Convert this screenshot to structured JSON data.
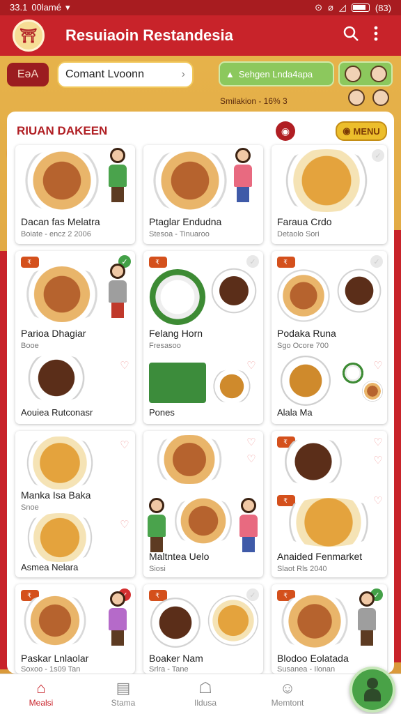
{
  "status_bar": {
    "time": "33.1",
    "carrier": "00lamé",
    "battery": "(83)"
  },
  "app_bar": {
    "logo_glyph": "⛩",
    "title": "Resuiaoin Restandesia"
  },
  "filter": {
    "back_label": "EəA",
    "dropdown_value": "Comant Lvoonn",
    "select_label": "Sehgen Lnda4apa",
    "simulation": "Smilakion - 16% 3"
  },
  "section": {
    "title": "RIUAN DAKEEN",
    "menu_label": "MENU"
  },
  "cards": [
    {
      "title": "Dacan fas Melatra",
      "sub": "Boiate - encz 2 2006"
    },
    {
      "title": "Ptaglar Endudna",
      "sub": "Stesoa - Tinuaroo"
    },
    {
      "title": "Faraua Crdo",
      "sub": "Detaolo Sori"
    },
    {
      "title": "Parioa Dhagiar",
      "sub": "Booe",
      "badge": "₹ "
    },
    {
      "title": "Felang Horn",
      "sub": "Fresasoo",
      "badge": "₹ "
    },
    {
      "title": "Podaka Runa",
      "sub": "Sgo Ocore 700",
      "badge": "₹ "
    },
    {
      "title": "Aouiea Rutconasr"
    },
    {
      "title": "Pones"
    },
    {
      "title": "Alala Ma"
    },
    {
      "title": "Manka Isa Baka",
      "sub": "Snoe"
    },
    {
      "title": "Maltntea Uelo",
      "sub": "Siosi"
    },
    {
      "title": "Anaided Fenmarket",
      "sub": "Slaot Rls 2040",
      "badge": "₹ "
    },
    {
      "title": "Asmea Nelara"
    },
    {
      "title": "Paskar Lnlaolar",
      "sub": "Soxoo - 1s09 Tan",
      "badge": "₹ "
    },
    {
      "title": "Boaker Nam",
      "sub": "Srlra - Tane",
      "badge": "₹ "
    },
    {
      "title": "Blodoo Eolatada",
      "sub": "Susanea - Ilonan",
      "badge": "₹ "
    }
  ],
  "nav": [
    {
      "label": "Mealsi",
      "icon": "home-icon"
    },
    {
      "label": "Stama",
      "icon": "clipboard-icon"
    },
    {
      "label": "Ildusa",
      "icon": "chef-icon"
    },
    {
      "label": "Memtont",
      "icon": "people-icon"
    }
  ],
  "colors": {
    "brand": "#c8232a",
    "accent": "#ecbe2c",
    "green": "#49a247"
  }
}
